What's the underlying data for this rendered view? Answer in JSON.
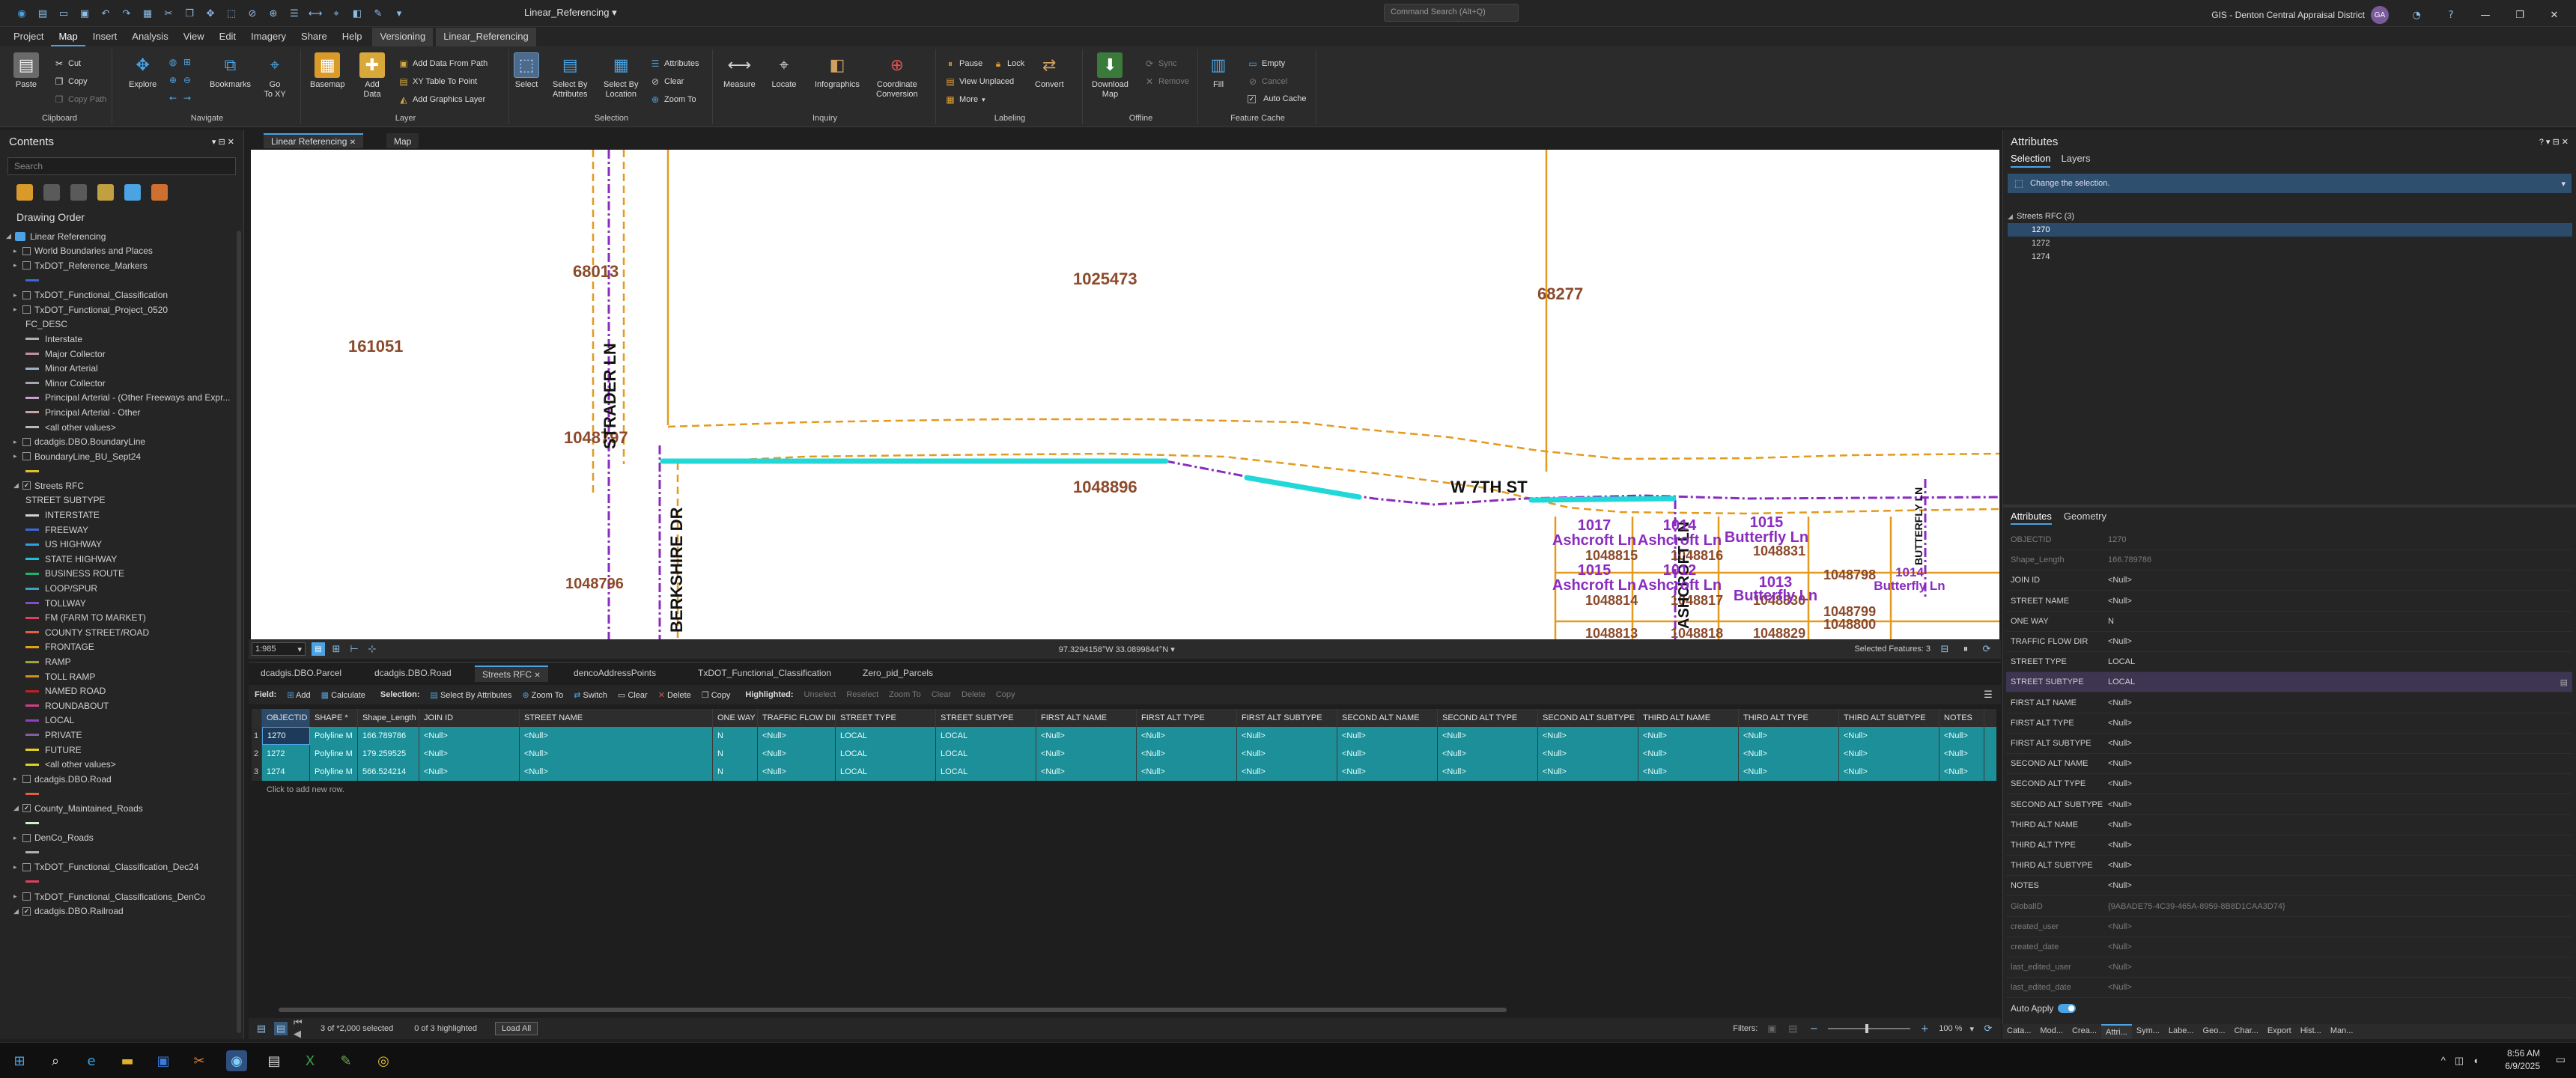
{
  "title_bar": {
    "title": "Linear_Referencing",
    "search_placeholder": "Command Search (Alt+Q)",
    "account": "GIS - Denton Central Appraisal District",
    "avatar": "GA"
  },
  "menu_tabs": [
    "Project",
    "Map",
    "Insert",
    "Analysis",
    "View",
    "Edit",
    "Imagery",
    "Share",
    "Help"
  ],
  "active_menu_tab": "Map",
  "context_tabs": [
    "Versioning",
    "Linear_Referencing"
  ],
  "ribbon": {
    "clipboard": {
      "label": "Clipboard",
      "paste": "Paste",
      "cut": "Cut",
      "copy": "Copy",
      "copy_path": "Copy Path"
    },
    "navigate": {
      "label": "Navigate",
      "explore": "Explore",
      "bookmarks": "Bookmarks",
      "go_to_xy": "Go\nTo XY"
    },
    "layer": {
      "label": "Layer",
      "basemap": "Basemap",
      "add_data": "Add\nData",
      "add_data_from_path": "Add Data From Path",
      "xy_table_to_point": "XY Table To Point",
      "add_graphics_layer": "Add Graphics Layer"
    },
    "selection": {
      "label": "Selection",
      "select": "Select",
      "select_by_attributes": "Select By\nAttributes",
      "select_by_location": "Select By\nLocation",
      "attributes": "Attributes",
      "clear": "Clear",
      "zoom_to": "Zoom To"
    },
    "inquiry": {
      "label": "Inquiry",
      "measure": "Measure",
      "locate": "Locate",
      "infographics": "Infographics",
      "coordinate_conversion": "Coordinate\nConversion"
    },
    "labeling": {
      "label": "Labeling",
      "pause": "Pause",
      "lock": "Lock",
      "view_unplaced": "View Unplaced",
      "more": "More",
      "convert": "Convert"
    },
    "offline": {
      "label": "Offline",
      "download_map": "Download\nMap",
      "sync": "Sync",
      "remove": "Remove"
    },
    "feature_cache": {
      "label": "Feature Cache",
      "fill": "Fill",
      "empty": "Empty",
      "cancel": "Cancel",
      "auto_cache": "Auto Cache"
    }
  },
  "contents": {
    "title": "Contents",
    "search_placeholder": "Search",
    "drawing_order": "Drawing Order",
    "tree": [
      {
        "text": "Linear Referencing",
        "level": 0,
        "kind": "map"
      },
      {
        "text": "World Boundaries and Places",
        "level": 1,
        "kind": "layer",
        "checked": false
      },
      {
        "text": "TxDOT_Reference_Markers",
        "level": 1,
        "kind": "layer",
        "checked": false
      },
      {
        "text": "",
        "level": 2,
        "kind": "sym",
        "color": "#3a6ad8"
      },
      {
        "text": "TxDOT_Functional_Classification",
        "level": 1,
        "kind": "layer",
        "checked": false
      },
      {
        "text": "TxDOT_Functional_Project_0520",
        "level": 1,
        "kind": "layer",
        "checked": false
      },
      {
        "text": "FC_DESC",
        "level": 2,
        "kind": "field"
      },
      {
        "text": "Interstate",
        "level": 2,
        "kind": "sym",
        "color": "#b0b0b0"
      },
      {
        "text": "Major Collector",
        "level": 2,
        "kind": "sym",
        "color": "#c090a0"
      },
      {
        "text": "Minor Arterial",
        "level": 2,
        "kind": "sym",
        "color": "#a0b0c8"
      },
      {
        "text": "Minor Collector",
        "level": 2,
        "kind": "sym",
        "color": "#a8a8a8"
      },
      {
        "text": "Principal Arterial - (Other Freeways and Expr...",
        "level": 2,
        "kind": "sym",
        "color": "#c7a0d0"
      },
      {
        "text": "Principal Arterial - Other",
        "level": 2,
        "kind": "sym",
        "color": "#d0a0a0"
      },
      {
        "text": "<all other values>",
        "level": 2,
        "kind": "sym",
        "color": "#b8b8b8"
      },
      {
        "text": "dcadgis.DBO.BoundaryLine",
        "level": 1,
        "kind": "layer",
        "checked": false
      },
      {
        "text": "BoundaryLine_BU_Sept24",
        "level": 1,
        "kind": "layer",
        "checked": false
      },
      {
        "text": "",
        "level": 2,
        "kind": "sym",
        "color": "#e0c030"
      },
      {
        "text": "Streets RFC",
        "level": 1,
        "kind": "layer",
        "checked": true
      },
      {
        "text": "STREET SUBTYPE",
        "level": 2,
        "kind": "field"
      },
      {
        "text": "INTERSTATE",
        "level": 2,
        "kind": "sym",
        "color": "#d0d0d0"
      },
      {
        "text": "FREEWAY",
        "level": 2,
        "kind": "sym",
        "color": "#3a6ad8"
      },
      {
        "text": "US HIGHWAY",
        "level": 2,
        "kind": "sym",
        "color": "#30a0e0"
      },
      {
        "text": "STATE HIGHWAY",
        "level": 2,
        "kind": "sym",
        "color": "#20c0d0"
      },
      {
        "text": "BUSINESS ROUTE",
        "level": 2,
        "kind": "sym",
        "color": "#20b070"
      },
      {
        "text": "LOOP/SPUR",
        "level": 2,
        "kind": "sym",
        "color": "#40a0c0"
      },
      {
        "text": "TOLLWAY",
        "level": 2,
        "kind": "sym",
        "color": "#8050c0"
      },
      {
        "text": "FM (FARM TO MARKET)",
        "level": 2,
        "kind": "sym",
        "color": "#e04060"
      },
      {
        "text": "COUNTY STREET/ROAD",
        "level": 2,
        "kind": "sym",
        "color": "#e06040"
      },
      {
        "text": "FRONTAGE",
        "level": 2,
        "kind": "sym",
        "color": "#e0a020"
      },
      {
        "text": "RAMP",
        "level": 2,
        "kind": "sym",
        "color": "#a0a040"
      },
      {
        "text": "TOLL RAMP",
        "level": 2,
        "kind": "sym",
        "color": "#d09020"
      },
      {
        "text": "NAMED ROAD",
        "level": 2,
        "kind": "sym",
        "color": "#c02020"
      },
      {
        "text": "ROUNDABOUT",
        "level": 2,
        "kind": "sym",
        "color": "#d04080"
      },
      {
        "text": "LOCAL",
        "level": 2,
        "kind": "sym",
        "color": "#9040c0"
      },
      {
        "text": "PRIVATE",
        "level": 2,
        "kind": "sym",
        "color": "#8060a0"
      },
      {
        "text": "FUTURE",
        "level": 2,
        "kind": "sym",
        "color": "#e0d020"
      },
      {
        "text": "<all other values>",
        "level": 2,
        "kind": "sym",
        "color": "#e0d020"
      },
      {
        "text": "dcadgis.DBO.Road",
        "level": 1,
        "kind": "layer",
        "checked": false
      },
      {
        "text": "",
        "level": 2,
        "kind": "sym",
        "color": "#e06040"
      },
      {
        "text": "County_Maintained_Roads",
        "level": 1,
        "kind": "layer",
        "checked": true
      },
      {
        "text": "",
        "level": 2,
        "kind": "sym",
        "color": "#c8f0d0"
      },
      {
        "text": "DenCo_Roads",
        "level": 1,
        "kind": "layer",
        "checked": false
      },
      {
        "text": "",
        "level": 2,
        "kind": "sym",
        "color": "#b0b0b0"
      },
      {
        "text": "TxDOT_Functional_Classification_Dec24",
        "level": 1,
        "kind": "layer",
        "checked": false
      },
      {
        "text": "",
        "level": 2,
        "kind": "sym",
        "color": "#e04060"
      },
      {
        "text": "TxDOT_Functional_Classifications_DenCo",
        "level": 1,
        "kind": "layer",
        "checked": false
      },
      {
        "text": "dcadgis.DBO.Railroad",
        "level": 1,
        "kind": "layer",
        "checked": true
      }
    ]
  },
  "view_tabs": [
    "Linear Referencing",
    "Map"
  ],
  "map": {
    "parcels": [
      "68013",
      "1025473",
      "68277",
      "161051",
      "1048797",
      "1048896",
      "1048796",
      "1048815",
      "1048816",
      "1048831",
      "1048798",
      "1048814",
      "1048817",
      "1048830",
      "1048799",
      "1048800",
      "1048813",
      "1048818",
      "1048829"
    ],
    "addresses": [
      "1017",
      "Ashcroft Ln",
      "1014",
      "Ashcroft Ln",
      "1015",
      "Butterfly Ln",
      "1015",
      "Ashcroft Ln",
      "1012",
      "Ashcroft Ln",
      "1013",
      "Butterfly Ln",
      "1014",
      "Butterfly Ln"
    ],
    "streets": [
      "STRADER LN",
      "BERKSHIRE DR",
      "W 7TH ST",
      "ASHCROFT LN",
      "BUTTERFLY LN"
    ],
    "colors": {
      "parcel": "#e39a1f",
      "street": "#8a2cc0",
      "selection": "#21d8d8",
      "parcel_label": "#8b4a2b",
      "address": "#8a2cc0"
    }
  },
  "map_status": {
    "scale": "1:985",
    "coords": "97.3294158°W 33.0899844°N",
    "selected_features": "Selected Features: 3"
  },
  "table_tabs": [
    "dcadgis.DBO.Parcel",
    "dcadgis.DBO.Road",
    "Streets RFC",
    "dencoAddressPoints",
    "TxDOT_Functional_Classification",
    "Zero_pid_Parcels"
  ],
  "active_table_tab": "Streets RFC",
  "table_toolbar": {
    "field": "Field:",
    "add": "Add",
    "calculate": "Calculate",
    "selection": "Selection:",
    "select_by_attributes": "Select By Attributes",
    "zoom_to": "Zoom To",
    "switch": "Switch",
    "clear": "Clear",
    "delete": "Delete",
    "copy": "Copy",
    "highlighted": "Highlighted:",
    "h_unselect": "Unselect",
    "h_reselect": "Reselect",
    "h_zoom_to": "Zoom To",
    "h_clear": "Clear",
    "h_delete": "Delete",
    "h_copy": "Copy"
  },
  "table": {
    "columns": [
      "OBJECTID *",
      "SHAPE *",
      "Shape_Length",
      "JOIN ID",
      "STREET NAME",
      "ONE WAY",
      "TRAFFIC FLOW DIR",
      "STREET TYPE",
      "STREET SUBTYPE",
      "FIRST ALT NAME",
      "FIRST ALT TYPE",
      "FIRST ALT SUBTYPE",
      "SECOND ALT NAME",
      "SECOND ALT TYPE",
      "SECOND ALT SUBTYPE",
      "THIRD ALT NAME",
      "THIRD ALT TYPE",
      "THIRD ALT SUBTYPE",
      "NOTES"
    ],
    "rows": [
      [
        "1270",
        "Polyline M",
        "166.789786",
        "<Null>",
        "<Null>",
        "N",
        "<Null>",
        "LOCAL",
        "LOCAL",
        "<Null>",
        "<Null>",
        "<Null>",
        "<Null>",
        "<Null>",
        "<Null>",
        "<Null>",
        "<Null>",
        "<Null>",
        "<Null>"
      ],
      [
        "1272",
        "Polyline M",
        "179.259525",
        "<Null>",
        "<Null>",
        "N",
        "<Null>",
        "LOCAL",
        "LOCAL",
        "<Null>",
        "<Null>",
        "<Null>",
        "<Null>",
        "<Null>",
        "<Null>",
        "<Null>",
        "<Null>",
        "<Null>",
        "<Null>"
      ],
      [
        "1274",
        "Polyline M",
        "566.524214",
        "<Null>",
        "<Null>",
        "N",
        "<Null>",
        "LOCAL",
        "LOCAL",
        "<Null>",
        "<Null>",
        "<Null>",
        "<Null>",
        "<Null>",
        "<Null>",
        "<Null>",
        "<Null>",
        "<Null>",
        "<Null>"
      ]
    ],
    "add_row_text": "Click to add new row.",
    "status_selected": "3 of *2,000 selected",
    "status_highlighted": "0 of 3 highlighted",
    "load_all": "Load All",
    "filters": "Filters:",
    "zoom": "100 %"
  },
  "attributes_pane": {
    "title": "Attributes",
    "tabs": [
      "Selection",
      "Layers"
    ],
    "change_selection": "Change the selection.",
    "layer_node": "Streets RFC (3)",
    "ids": [
      "1270",
      "1272",
      "1274"
    ],
    "sub_tabs": [
      "Attributes",
      "Geometry"
    ],
    "fields": [
      {
        "k": "OBJECTID",
        "v": "1270",
        "ro": true
      },
      {
        "k": "Shape_Length",
        "v": "166.789786",
        "ro": true
      },
      {
        "k": "JOIN ID",
        "v": "<Null>"
      },
      {
        "k": "STREET NAME",
        "v": "<Null>"
      },
      {
        "k": "ONE WAY",
        "v": "N"
      },
      {
        "k": "TRAFFIC FLOW DIR",
        "v": "<Null>"
      },
      {
        "k": "STREET TYPE",
        "v": "LOCAL"
      },
      {
        "k": "STREET SUBTYPE",
        "v": "LOCAL",
        "hl": true
      },
      {
        "k": "FIRST ALT NAME",
        "v": "<Null>"
      },
      {
        "k": "FIRST ALT TYPE",
        "v": "<Null>"
      },
      {
        "k": "FIRST ALT SUBTYPE",
        "v": "<Null>"
      },
      {
        "k": "SECOND ALT NAME",
        "v": "<Null>"
      },
      {
        "k": "SECOND ALT TYPE",
        "v": "<Null>"
      },
      {
        "k": "SECOND ALT SUBTYPE",
        "v": "<Null>"
      },
      {
        "k": "THIRD ALT NAME",
        "v": "<Null>"
      },
      {
        "k": "THIRD ALT TYPE",
        "v": "<Null>"
      },
      {
        "k": "THIRD ALT SUBTYPE",
        "v": "<Null>"
      },
      {
        "k": "NOTES",
        "v": "<Null>"
      },
      {
        "k": "GlobalID",
        "v": "{9ABADE75-4C39-465A-8959-8B8D1CAA3D74}",
        "ro": true
      },
      {
        "k": "created_user",
        "v": "<Null>",
        "ro": true
      },
      {
        "k": "created_date",
        "v": "<Null>",
        "ro": true
      },
      {
        "k": "last_edited_user",
        "v": "<Null>",
        "ro": true
      },
      {
        "k": "last_edited_date",
        "v": "<Null>",
        "ro": true
      }
    ],
    "auto_apply": "Auto Apply"
  },
  "pane_tabs": [
    "Cata...",
    "Mod...",
    "Crea...",
    "Attri...",
    "Sym...",
    "Labe...",
    "Geo...",
    "Char...",
    "Export",
    "Hist...",
    "Man..."
  ],
  "taskbar": {
    "time": "8:56 AM",
    "date": "6/9/2025"
  }
}
